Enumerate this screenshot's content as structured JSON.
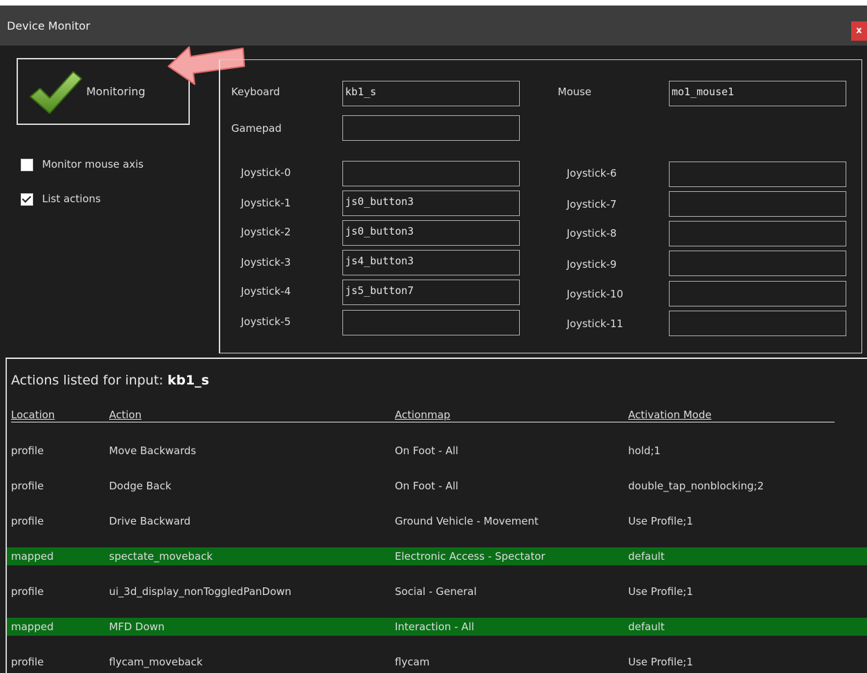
{
  "window": {
    "title": "Device Monitor",
    "close_label": "x"
  },
  "monitor_button": {
    "label": "Monitoring",
    "icon": "checkmark-icon"
  },
  "options": {
    "monitor_mouse_axis": {
      "label": "Monitor mouse axis",
      "checked": false
    },
    "list_actions": {
      "label": "List actions",
      "checked": true
    }
  },
  "devices": {
    "keyboard": {
      "label": "Keyboard",
      "value": "kb1_s"
    },
    "mouse": {
      "label": "Mouse",
      "value": "mo1_mouse1"
    },
    "gamepad": {
      "label": "Gamepad",
      "value": ""
    },
    "joysticks": [
      {
        "label": "Joystick-0",
        "value": ""
      },
      {
        "label": "Joystick-1",
        "value": "js0_button3"
      },
      {
        "label": "Joystick-2",
        "value": "js0_button3"
      },
      {
        "label": "Joystick-3",
        "value": "js4_button3"
      },
      {
        "label": "Joystick-4",
        "value": "js5_button7"
      },
      {
        "label": "Joystick-5",
        "value": ""
      },
      {
        "label": "Joystick-6",
        "value": ""
      },
      {
        "label": "Joystick-7",
        "value": ""
      },
      {
        "label": "Joystick-8",
        "value": ""
      },
      {
        "label": "Joystick-9",
        "value": ""
      },
      {
        "label": "Joystick-10",
        "value": ""
      },
      {
        "label": "Joystick-11",
        "value": ""
      }
    ]
  },
  "actions": {
    "heading_prefix": "Actions listed for input:",
    "heading_input": "kb1_s",
    "columns": [
      "Location",
      "Action",
      "Actionmap",
      "Activation Mode"
    ],
    "rows": [
      {
        "location": "profile",
        "action": "Move Backwards",
        "actionmap": "On Foot - All",
        "mode": "hold;1",
        "highlight": false
      },
      {
        "location": "profile",
        "action": "Dodge Back",
        "actionmap": "On Foot - All",
        "mode": "double_tap_nonblocking;2",
        "highlight": false
      },
      {
        "location": "profile",
        "action": "Drive Backward",
        "actionmap": "Ground Vehicle - Movement",
        "mode": "Use Profile;1",
        "highlight": false
      },
      {
        "location": "mapped",
        "action": "spectate_moveback",
        "actionmap": "Electronic Access - Spectator",
        "mode": "default",
        "highlight": true
      },
      {
        "location": "profile",
        "action": "ui_3d_display_nonToggledPanDown",
        "actionmap": "Social - General",
        "mode": "Use Profile;1",
        "highlight": false
      },
      {
        "location": "mapped",
        "action": "MFD Down",
        "actionmap": "Interaction - All",
        "mode": "default",
        "highlight": true
      },
      {
        "location": "profile",
        "action": "flycam_moveback",
        "actionmap": "flycam",
        "mode": "Use Profile;1",
        "highlight": false
      }
    ]
  },
  "colors": {
    "background": "#1e1e1e",
    "titlebar": "#3d3d3d",
    "close": "#d63a3a",
    "mapped_row": "#0a6e17",
    "arrow": "#f4a6a6"
  }
}
